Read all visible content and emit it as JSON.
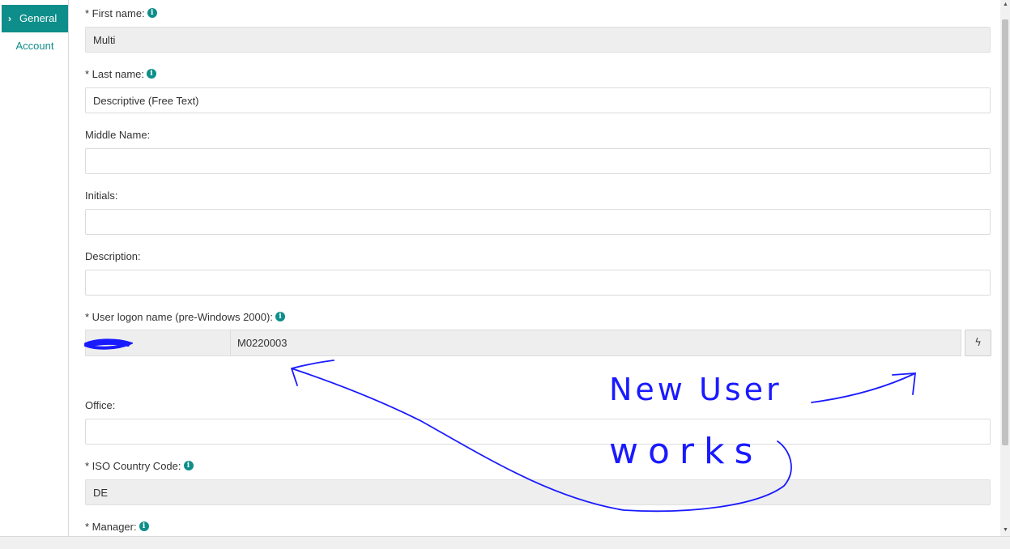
{
  "sidebar": {
    "items": [
      {
        "label": "General",
        "chevron": "›"
      },
      {
        "label": "Account"
      }
    ]
  },
  "form": {
    "first_name": {
      "label": "* First name:",
      "value": "Multi"
    },
    "last_name": {
      "label": "* Last name:",
      "value": "Descriptive (Free Text)"
    },
    "middle_name": {
      "label": "Middle Name:",
      "value": ""
    },
    "initials": {
      "label": "Initials:",
      "value": ""
    },
    "description": {
      "label": "Description:",
      "value": ""
    },
    "logon_name": {
      "label": "* User logon name (pre-Windows 2000):",
      "value": "M0220003"
    },
    "office": {
      "label": "Office:",
      "value": ""
    },
    "iso_country": {
      "label": "* ISO Country Code:",
      "value": "DE"
    },
    "manager": {
      "label": "* Manager:"
    }
  },
  "info_glyph": "i",
  "generate_glyph": "ϟ",
  "annotation": {
    "line1": "New User",
    "line2": "works",
    "color": "#1a1aff"
  },
  "colors": {
    "accent": "#0e8e8a",
    "disabled_bg": "#eeeeee"
  }
}
